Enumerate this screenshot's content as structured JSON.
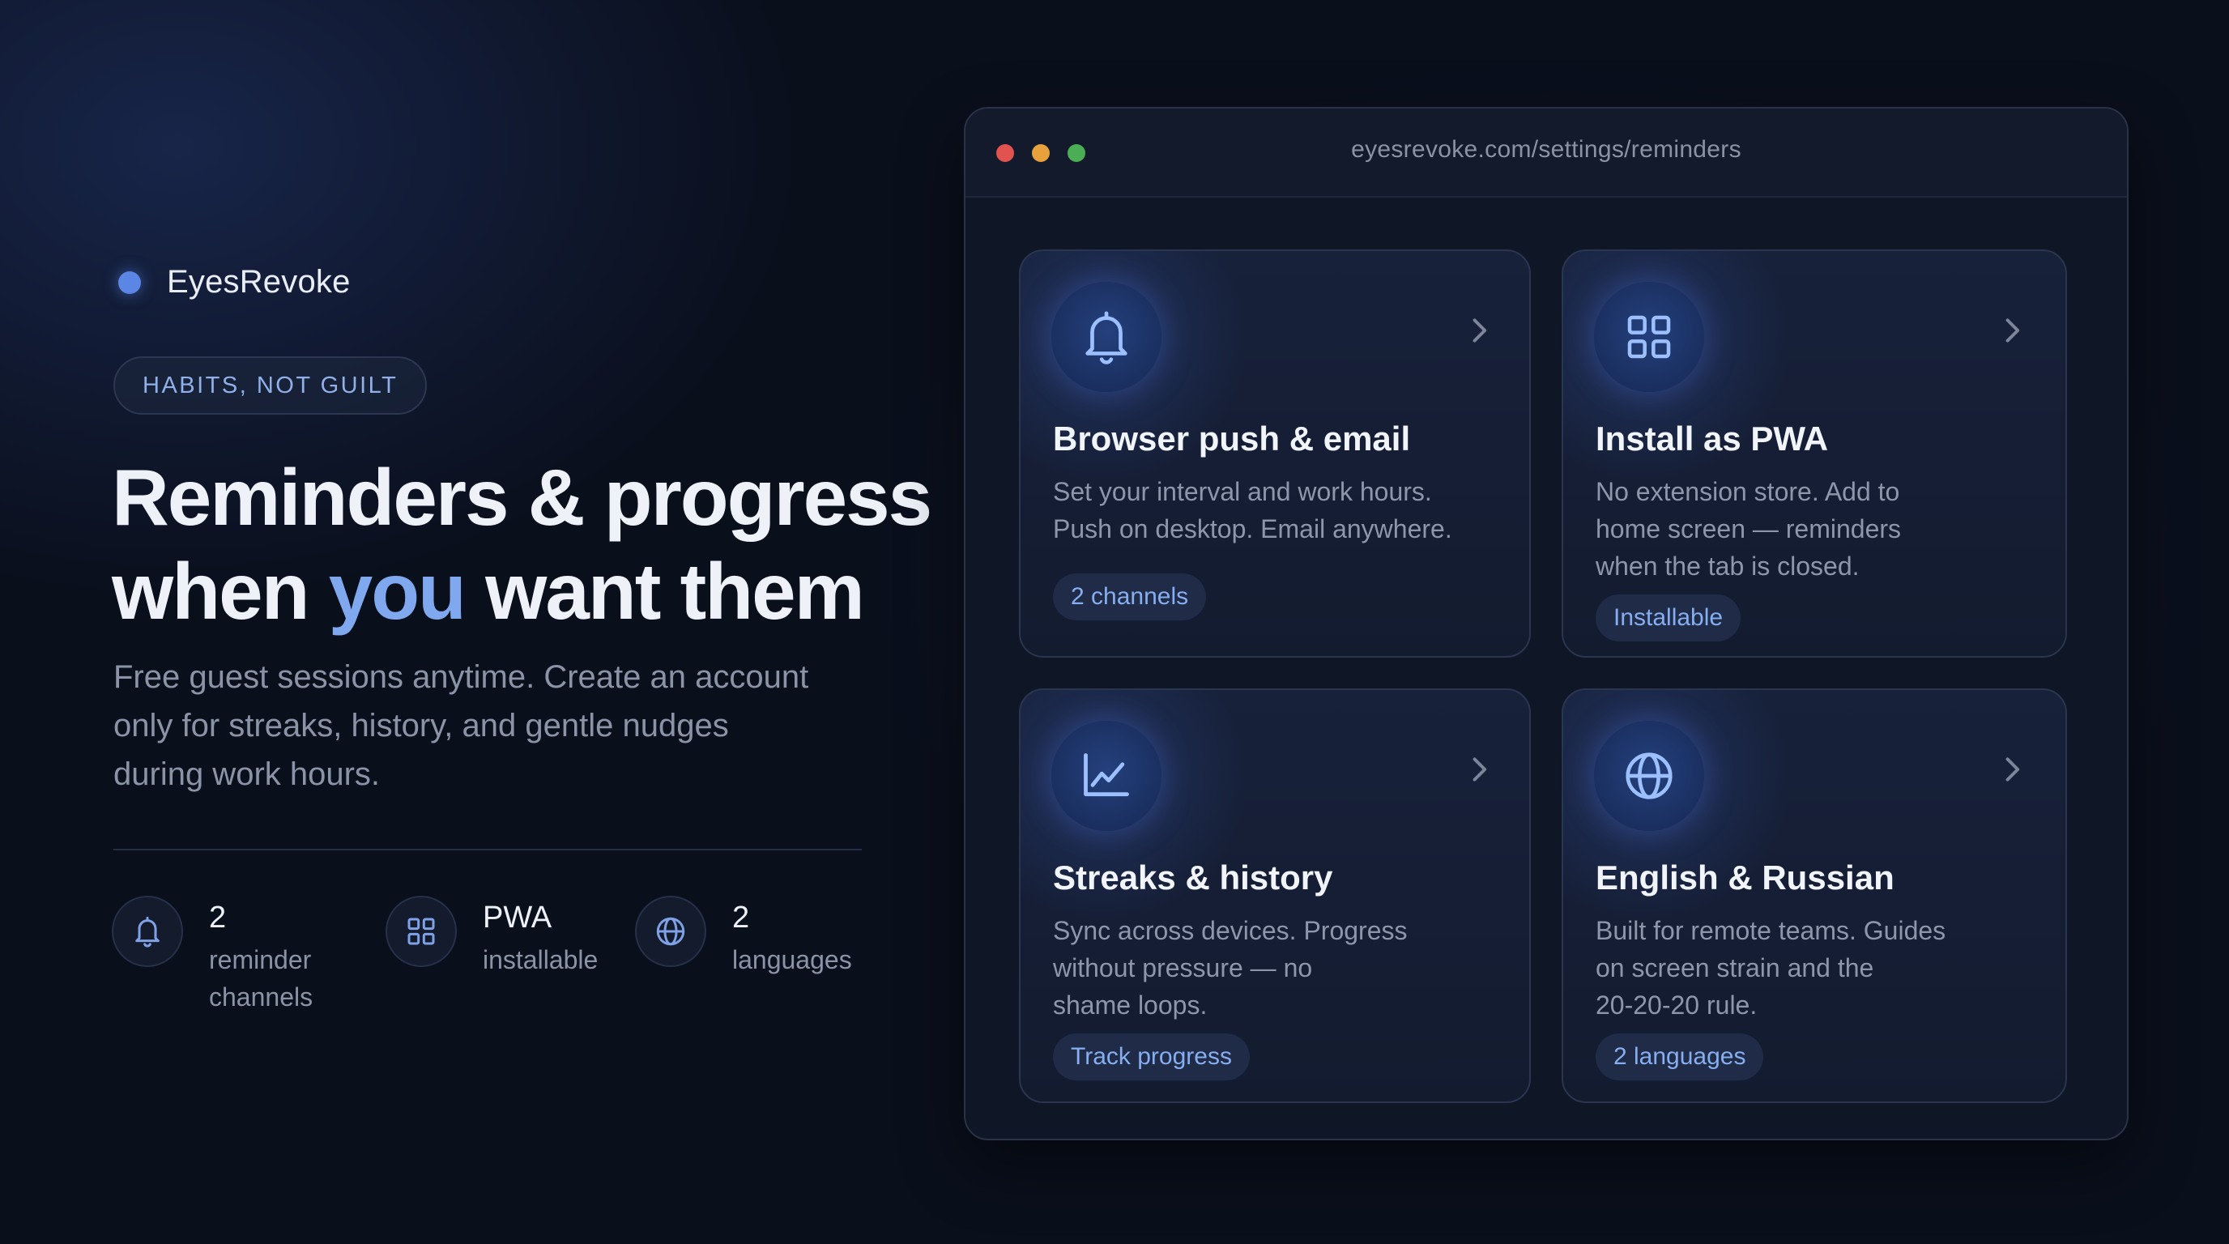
{
  "brand": {
    "name": "EyesRevoke",
    "dot_color": "#5b86e5"
  },
  "hero": {
    "pill": "HABITS, NOT GUILT",
    "headline_line1": "Reminders & progress",
    "headline_line2_pre": "when ",
    "headline_highlight": "you",
    "headline_line2_post": " want them",
    "subtitle_lines": [
      "Free guest sessions anytime. Create an account",
      "only for streaks, history, and gentle nudges",
      "during work hours."
    ],
    "accent_color": "#7fa8ef"
  },
  "stats": [
    {
      "icon": "bell-icon",
      "value": "2",
      "label_lines": [
        "reminder",
        "channels"
      ]
    },
    {
      "icon": "grid-icon",
      "value": "PWA",
      "label_lines": [
        "installable"
      ]
    },
    {
      "icon": "globe-icon",
      "value": "2",
      "label_lines": [
        "languages"
      ]
    }
  ],
  "browser": {
    "url": "eyesrevoke.com/settings/reminders",
    "traffic_lights": [
      "#e0534e",
      "#e9a23b",
      "#4cae54"
    ]
  },
  "cards": [
    {
      "icon": "bell-icon",
      "title": "Browser push & email",
      "desc_lines": [
        "Set your interval and work hours.",
        "Push on desktop. Email anywhere."
      ],
      "tag": "2 channels"
    },
    {
      "icon": "grid-icon",
      "title": "Install as PWA",
      "desc_lines": [
        "No extension store. Add to",
        "home screen — reminders",
        "when the tab is closed."
      ],
      "tag": "Installable"
    },
    {
      "icon": "chart-line-icon",
      "title": "Streaks & history",
      "desc_lines": [
        "Sync across devices. Progress",
        "without pressure — no",
        "shame loops."
      ],
      "tag": "Track progress"
    },
    {
      "icon": "globe-icon",
      "title": "English & Russian",
      "desc_lines": [
        "Built for remote teams. Guides",
        "on screen strain and the",
        "20-20-20 rule."
      ],
      "tag": "2 languages"
    }
  ]
}
